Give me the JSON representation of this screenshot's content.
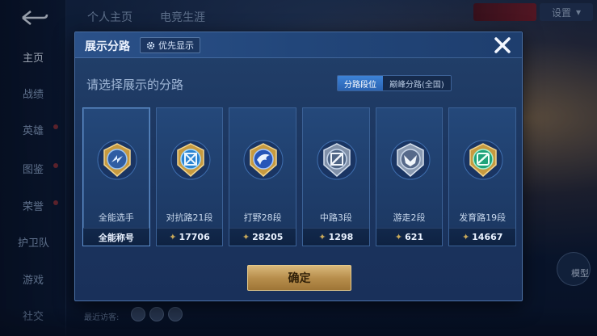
{
  "nav": {
    "items": [
      {
        "label": "主页",
        "active": true
      },
      {
        "label": "战绩"
      },
      {
        "label": "英雄"
      },
      {
        "label": "图鉴"
      },
      {
        "label": "荣誉"
      },
      {
        "label": "护卫队"
      },
      {
        "label": "游戏"
      },
      {
        "label": "社交"
      }
    ]
  },
  "top_tabs": [
    "个人主页",
    "电竞生涯"
  ],
  "settings_label": "设置",
  "right_button_label": "模型",
  "recent_visitors_label": "最近访客:",
  "modal": {
    "title": "展示分路",
    "priority_button": "优先显示",
    "subtitle": "请选择展示的分路",
    "toggle": {
      "active": "分路段位",
      "inactive": "巅峰分路(全国)"
    },
    "cards": [
      {
        "name": "全能选手",
        "footer": "全能称号",
        "icon": "all-round-emblem-icon",
        "accent": "#4f86c9"
      },
      {
        "name": "对抗路21段",
        "footer_value": "17706",
        "icon": "clash-lane-emblem-icon",
        "accent": "#56a8e6"
      },
      {
        "name": "打野28段",
        "footer_value": "28205",
        "icon": "jungle-emblem-icon",
        "accent": "#4a7ed8"
      },
      {
        "name": "中路3段",
        "footer_value": "1298",
        "icon": "mid-lane-emblem-icon",
        "accent": "#7f93b0"
      },
      {
        "name": "游走2段",
        "footer_value": "621",
        "icon": "roam-emblem-icon",
        "accent": "#8aa0bf"
      },
      {
        "name": "发育路19段",
        "footer_value": "14667",
        "icon": "farm-lane-emblem-icon",
        "accent": "#3bbf8f"
      }
    ],
    "confirm_label": "确定"
  },
  "colors": {
    "gold": "#c9a95a",
    "modal_bg": "#1f3e6c",
    "toggle_active": "#3d82d6"
  }
}
